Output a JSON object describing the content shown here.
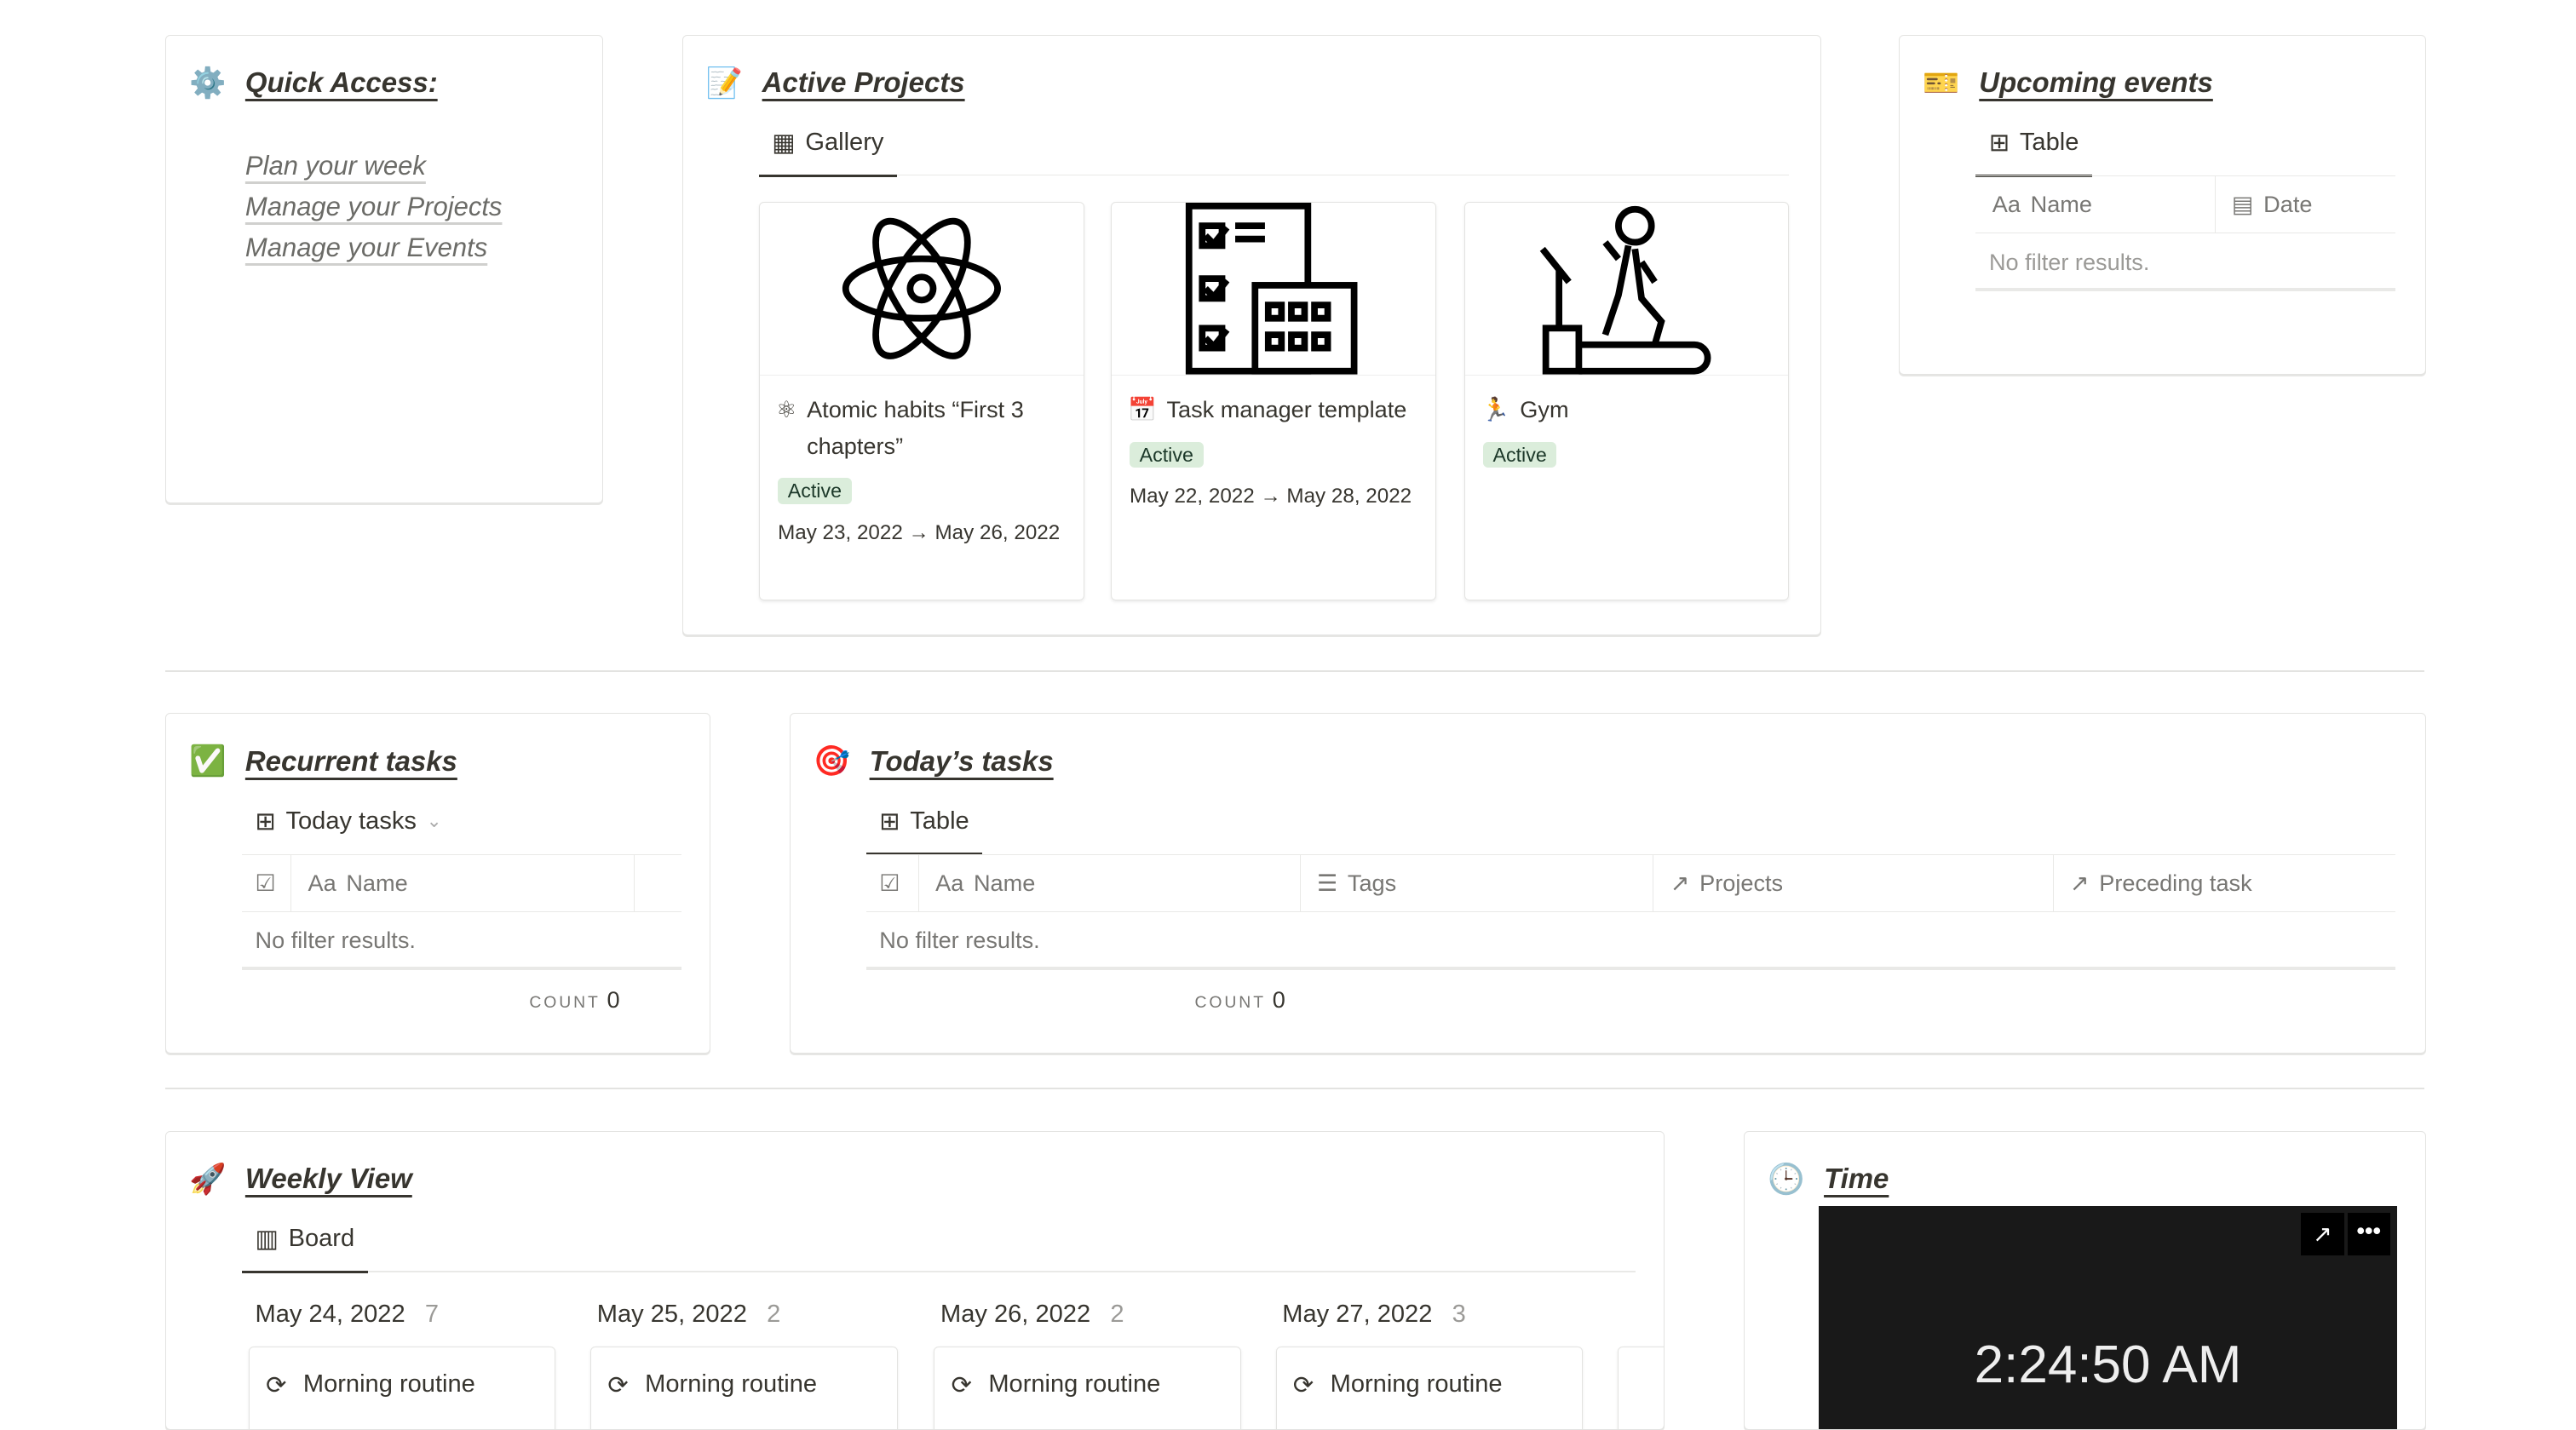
{
  "quick_access": {
    "title": "Quick Access:",
    "icon": "gear-icon",
    "links": [
      "Plan your week",
      "Manage your Projects",
      "Manage your Events"
    ]
  },
  "active_projects": {
    "title": "Active Projects",
    "icon": "memo-icon",
    "tab": "Gallery",
    "cards": [
      {
        "name": "Atomic habits “First 3 chapters”",
        "status": "Active",
        "date": "May 23, 2022 → May 26, 2022",
        "icon": "atom-icon"
      },
      {
        "name": "Task manager template",
        "status": "Active",
        "date": "May 22, 2022 → May 28, 2022",
        "icon": "task-calendar-icon"
      },
      {
        "name": "Gym",
        "status": "Active",
        "date": "",
        "icon": "treadmill-icon"
      }
    ],
    "status_color": "#dbeddb"
  },
  "upcoming_events": {
    "title": "Upcoming events",
    "icon": "ticket-icon",
    "tab": "Table",
    "columns": [
      "Name",
      "Date"
    ],
    "empty": "No filter results."
  },
  "recurrent_tasks": {
    "title": "Recurrent tasks",
    "icon": "check-mark-icon",
    "tab": "Today tasks",
    "columns": [
      "Name"
    ],
    "empty": "No filter results.",
    "count_label": "COUNT",
    "count": "0"
  },
  "todays_tasks": {
    "title": "Today’s tasks",
    "icon": "target-icon",
    "tab": "Table",
    "columns": [
      "Name",
      "Tags",
      "Projects",
      "Preceding task"
    ],
    "empty": "No filter results.",
    "count_label": "COUNT",
    "count": "0"
  },
  "weekly_view": {
    "title": "Weekly View",
    "icon": "rocket-icon",
    "tab": "Board",
    "columns": [
      {
        "date": "May 24, 2022",
        "count": "7",
        "first": "Morning routine"
      },
      {
        "date": "May 25, 2022",
        "count": "2",
        "first": "Morning routine"
      },
      {
        "date": "May 26, 2022",
        "count": "2",
        "first": "Morning routine"
      },
      {
        "date": "May 27, 2022",
        "count": "3",
        "first": "Morning routine"
      }
    ]
  },
  "time": {
    "title": "Time",
    "icon": "clock-icon",
    "clock": "2:24:50 AM"
  },
  "aa": "Aa"
}
